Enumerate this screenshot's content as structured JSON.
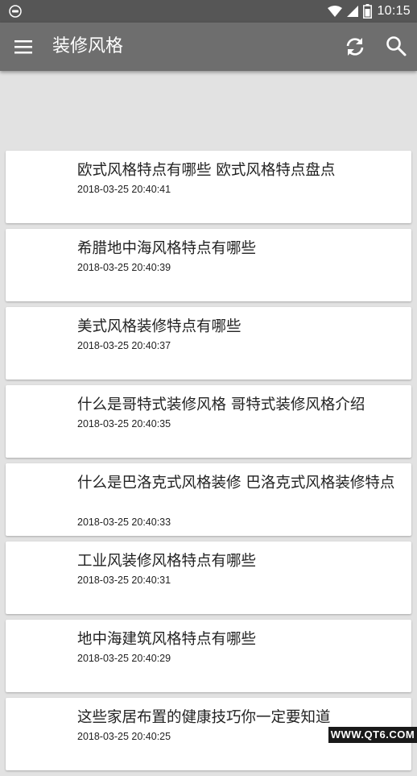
{
  "status_bar": {
    "time": "10:15"
  },
  "app_bar": {
    "title": "装修风格",
    "icons": [
      "menu-icon",
      "refresh-icon",
      "search-icon"
    ]
  },
  "articles": [
    {
      "title": "欧式风格特点有哪些 欧式风格特点盘点",
      "time": "2018-03-25 20:40:41"
    },
    {
      "title": "希腊地中海风格特点有哪些",
      "time": "2018-03-25 20:40:39"
    },
    {
      "title": "美式风格装修特点有哪些",
      "time": "2018-03-25 20:40:37"
    },
    {
      "title": "什么是哥特式装修风格 哥特式装修风格介绍",
      "time": "2018-03-25 20:40:35"
    },
    {
      "title": "什么是巴洛克式风格装修 巴洛克式风格装修特点",
      "time": "2018-03-25 20:40:33"
    },
    {
      "title": "工业风装修风格特点有哪些",
      "time": "2018-03-25 20:40:31"
    },
    {
      "title": "地中海建筑风格特点有哪些",
      "time": "2018-03-25 20:40:29"
    },
    {
      "title": "这些家居布置的健康技巧你一定要知道",
      "time": "2018-03-25 20:40:25"
    }
  ],
  "watermark": "WWW.QT6.COM",
  "colors": {
    "status_bar": "#565656",
    "app_bar": "#6e6e6e",
    "background": "#e2e2e2",
    "card": "#ffffff"
  }
}
